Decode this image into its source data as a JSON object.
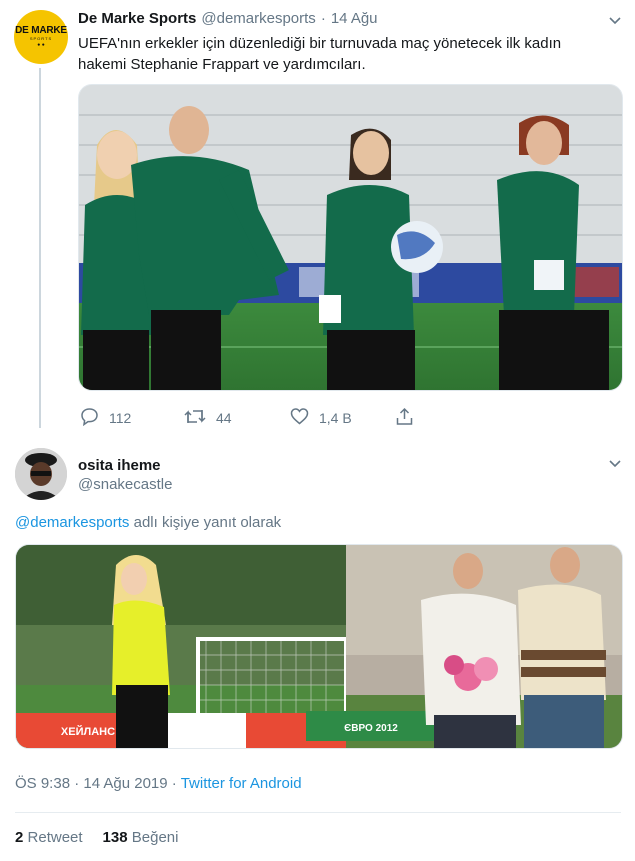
{
  "tweet1": {
    "author_name": "De Marke Sports",
    "handle": "@demarkesports",
    "dot": "·",
    "date": "14 Ağu",
    "text": "UEFA'nın erkekler için düzenlediği bir turnuvada maç yönetecek ilk kadın hakemi Stephanie Frappart ve yardımcıları.",
    "avatar_logo": "DE MARKE",
    "avatar_sub": "SPORTS",
    "actions": {
      "reply_count": "112",
      "retweet_count": "44",
      "like_count": "1,4 B"
    }
  },
  "tweet2": {
    "author_name": "osita iheme",
    "handle": "@snakecastle",
    "reply_to_mention": "@demarkesports",
    "reply_to_text": "adlı kişiye yanıt olarak",
    "timestamp": "ÖS 9:38 · 14 Ağu 2019 ·",
    "source": "Twitter for Android",
    "retweets": {
      "count": "2",
      "label": "Retweet"
    },
    "likes": {
      "count": "138",
      "label": "Beğeni"
    },
    "image_text": {
      "banner_left": "ХЕЙЛАНС",
      "banner_right": "ЄВРО 2012"
    }
  },
  "colors": {
    "accent": "#1b95e0",
    "secondary_text": "#657786",
    "kit_green": "#136b4b",
    "divider": "#e6ecf0"
  },
  "icons": [
    "chevron-down-icon",
    "reply-icon",
    "retweet-icon",
    "like-icon",
    "share-icon"
  ]
}
